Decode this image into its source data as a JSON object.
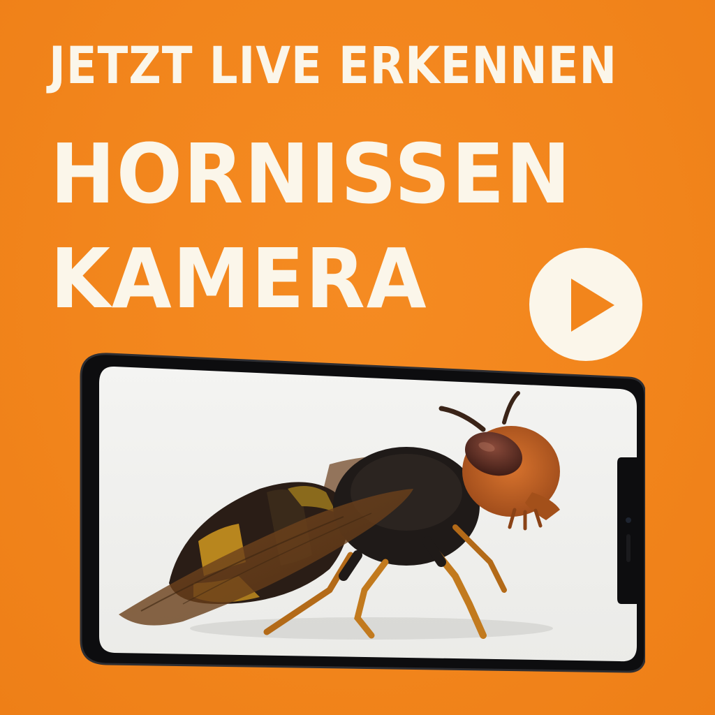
{
  "headline": {
    "line1": "JETZT LIVE ERKENNEN",
    "line2": "HORNISSEN",
    "line3": "KAMERA"
  },
  "play_button": {
    "icon": "play-icon"
  },
  "phone": {
    "screen_content": "hornet-photo"
  },
  "colors": {
    "background": "#f2851c",
    "text": "#fbf6ea",
    "accent": "#f2851c"
  }
}
